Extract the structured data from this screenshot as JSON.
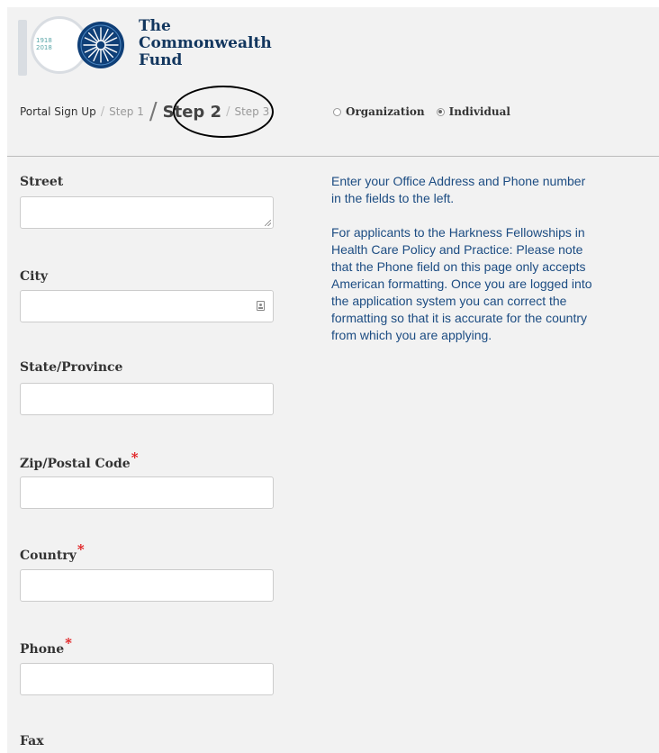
{
  "brand": {
    "logo_digit": "1",
    "years": [
      "1918",
      "2018"
    ],
    "name_lines": [
      "The",
      "Commonwealth",
      "Fund"
    ]
  },
  "breadcrumb": {
    "items": [
      "Portal Sign Up",
      "Step 1",
      "Step 2",
      "Step 3"
    ],
    "current_index": 2
  },
  "account_type": {
    "options": [
      "Organization",
      "Individual"
    ],
    "selected": "Individual"
  },
  "form": {
    "fields": [
      {
        "label": "Street",
        "required": false,
        "value": ""
      },
      {
        "label": "City",
        "required": false,
        "value": ""
      },
      {
        "label": "State/Province",
        "required": false,
        "value": ""
      },
      {
        "label": "Zip/Postal Code",
        "required": true,
        "value": ""
      },
      {
        "label": "Country",
        "required": true,
        "value": ""
      },
      {
        "label": "Phone",
        "required": true,
        "value": ""
      },
      {
        "label": "Fax",
        "required": false,
        "value": ""
      }
    ],
    "required_marker": "*"
  },
  "help": {
    "paragraph1": "Enter your Office Address and Phone number\nin the fields to the left.",
    "paragraph2": "For applicants to the Harkness Fellowships in\nHealth Care Policy and Practice: Please note\nthat the Phone field on this page only accepts\nAmerican formatting. Once you are logged into\nthe application system you can correct the\nformatting so that it is accurate for the country\nfrom which you are applying."
  },
  "colors": {
    "help_text": "#1c4c82",
    "required": "#e0191b",
    "brand_navy": "#0f3f77"
  }
}
